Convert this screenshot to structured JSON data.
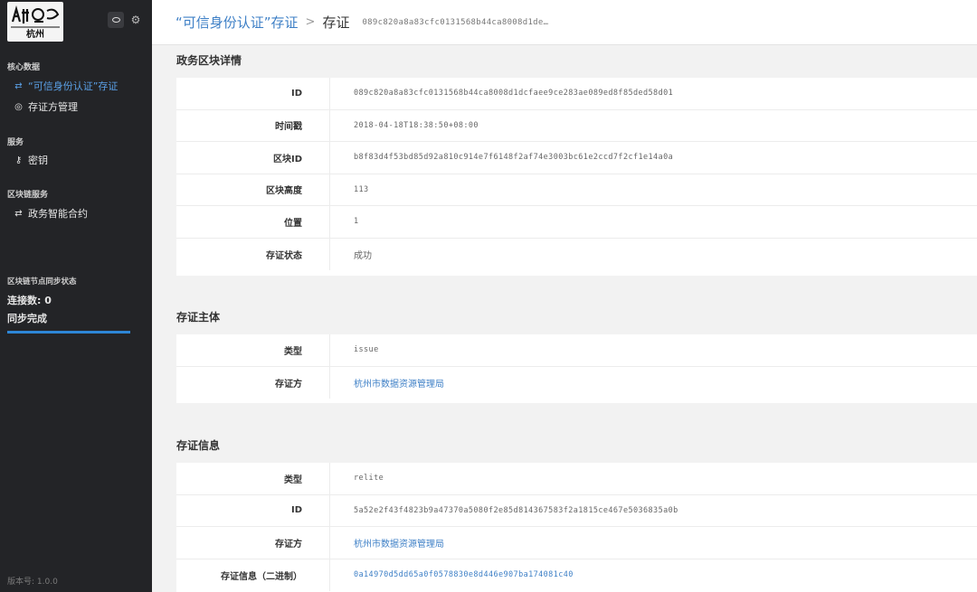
{
  "sidebar": {
    "logo_text": "杭州",
    "sections": {
      "core": "核心数据",
      "service": "服务",
      "blockchain_service": "区块链服务"
    },
    "items": {
      "trusted_identity": "“可信身份认证”存证",
      "depositor_mgmt": "存证方管理",
      "keys": "密钥",
      "gov_contract": "政务智能合约"
    },
    "sync": {
      "title": "区块链节点同步状态",
      "connections": "连接数: 0",
      "status": "同步完成",
      "progress": 1.0
    },
    "version": "版本号: 1.0.0"
  },
  "header": {
    "breadcrumb_link": "“可信身份认证”存证",
    "separator": ">",
    "current": "存证",
    "hash": "089c820a8a83cfc0131568b44ca8008d1de…"
  },
  "sections": {
    "block_detail": {
      "title": "政务区块详情",
      "rows": [
        {
          "label": "ID",
          "value": "089c820a8a83cfc0131568b44ca8008d1dcfaee9ce283ae089ed8f85ded58d01"
        },
        {
          "label": "时间戳",
          "value": "2018-04-18T18:38:50+08:00"
        },
        {
          "label": "区块ID",
          "value": "b8f83d4f53bd85d92a810c914e7f6148f2af74e3003bc61e2ccd7f2cf1e14a0a"
        },
        {
          "label": "区块高度",
          "value": "113"
        },
        {
          "label": "位置",
          "value": "1"
        },
        {
          "label": "存证状态",
          "value": "成功"
        }
      ]
    },
    "subject": {
      "title": "存证主体",
      "rows": [
        {
          "label": "类型",
          "value": "issue"
        },
        {
          "label": "存证方",
          "value": "杭州市数据资源管理局"
        }
      ]
    },
    "info": {
      "title": "存证信息",
      "rows": [
        {
          "label": "类型",
          "value": "relite"
        },
        {
          "label": "ID",
          "value": "5a52e2f43f4823b9a47370a5080f2e85d814367583f2a1815ce467e5036835a0b"
        },
        {
          "label": "存证方",
          "value": "杭州市数据资源管理局"
        },
        {
          "label": "存证信息（二进制）",
          "value": "0a14970d5dd65a0f0578830e8d446e907ba174081c40"
        }
      ]
    }
  }
}
